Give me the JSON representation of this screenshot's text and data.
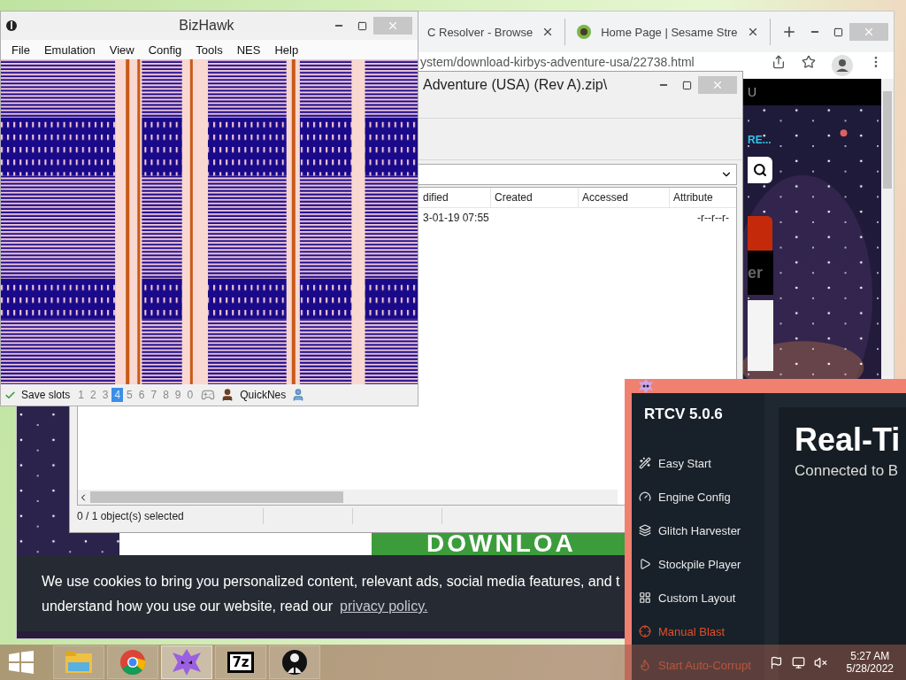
{
  "browser": {
    "tabs": [
      {
        "title": "C Resolver - Browse"
      },
      {
        "title": "Home Page | Sesame Stre"
      }
    ],
    "address": "ystem/download-kirbys-adventure-usa/22738.html",
    "page": {
      "header_text": "U",
      "more_link": "RE...",
      "badge_text": "er",
      "banner_text": "DOWNLOA",
      "cookie_line1": "We use cookies to bring you personalized content, relevant ads, social media features, and t",
      "cookie_line2": "understand how you use our website, read our",
      "cookie_link": "privacy policy."
    }
  },
  "archive_window": {
    "title": "Adventure (USA) (Rev A).zip\\",
    "columns": [
      "dified",
      "Created",
      "Accessed",
      "Attribute"
    ],
    "rows": [
      {
        "modified": "3-01-19 07:55",
        "attributes": "-r--r--r-"
      }
    ],
    "status": "0 / 1 object(s) selected"
  },
  "emulator_window": {
    "title": "BizHawk",
    "menu": [
      "File",
      "Emulation",
      "View",
      "Config",
      "Tools",
      "NES",
      "Help"
    ],
    "status": {
      "label": "Save slots",
      "slots": [
        {
          "label": "1",
          "selected": false
        },
        {
          "label": "2",
          "selected": false
        },
        {
          "label": "3",
          "selected": false
        },
        {
          "label": "4",
          "selected": true
        },
        {
          "label": "5",
          "selected": false
        },
        {
          "label": "6",
          "selected": false
        },
        {
          "label": "7",
          "selected": false
        },
        {
          "label": "8",
          "selected": false
        },
        {
          "label": "9",
          "selected": false
        },
        {
          "label": "0",
          "selected": false
        }
      ],
      "core": "QuickNes"
    }
  },
  "rtcv_window": {
    "version": "RTCV 5.0.6",
    "nav": [
      {
        "label": "Easy Start",
        "kind": "page"
      },
      {
        "label": "Engine Config",
        "kind": "page"
      },
      {
        "label": "Glitch Harvester",
        "kind": "page"
      },
      {
        "label": "Stockpile Player",
        "kind": "page"
      },
      {
        "label": "Custom Layout",
        "kind": "page"
      },
      {
        "label": "Manual Blast",
        "kind": "action"
      },
      {
        "label": "Start Auto-Corrupt",
        "kind": "action"
      }
    ],
    "heading": "Real-Ti",
    "subtitle": "Connected to B"
  },
  "taskbar": {
    "apps": [
      {
        "kind": "explorer",
        "selected": false
      },
      {
        "kind": "chrome",
        "selected": false
      },
      {
        "kind": "rtcv",
        "selected": true
      },
      {
        "kind": "archiver",
        "label": "7z",
        "selected": false
      },
      {
        "kind": "figure",
        "selected": false
      }
    ],
    "time": "5:27 AM",
    "date": "5/28/2022"
  }
}
